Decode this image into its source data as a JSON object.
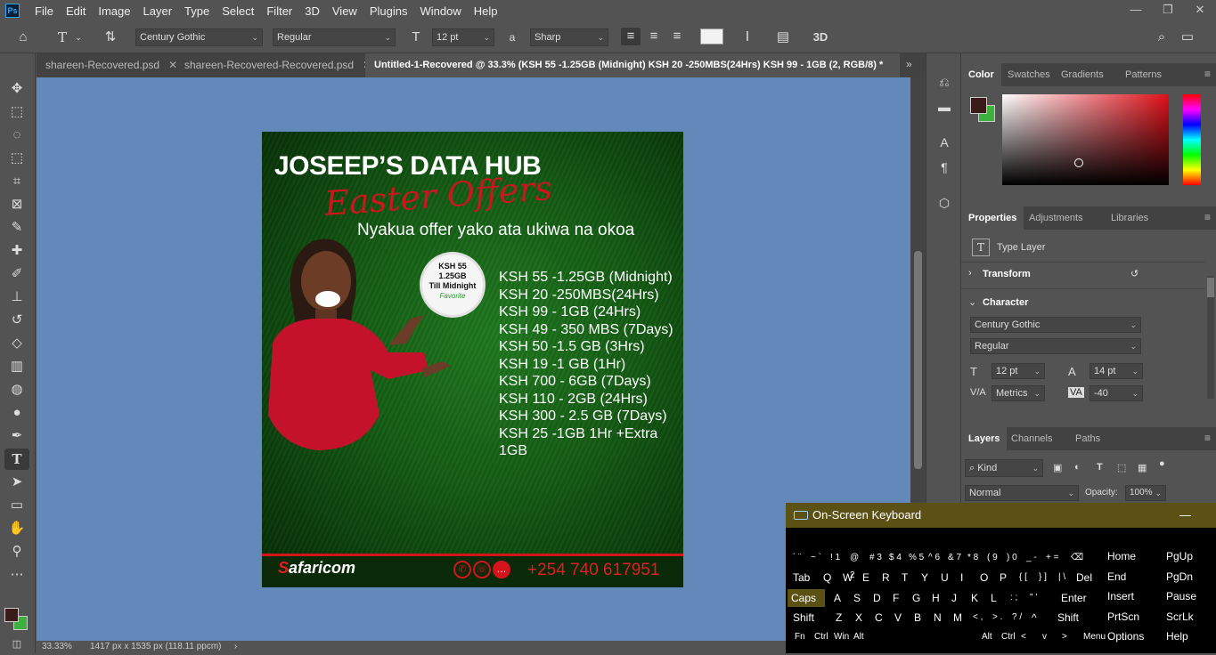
{
  "app": {
    "icon": "Ps"
  },
  "menu": [
    "File",
    "Edit",
    "Image",
    "Layer",
    "Type",
    "Select",
    "Filter",
    "3D",
    "View",
    "Plugins",
    "Window",
    "Help"
  ],
  "window_controls": {
    "minimize": "—",
    "restore": "❐",
    "close": "✕"
  },
  "options": {
    "font_family": "Century Gothic",
    "font_style": "Regular",
    "font_size": "12 pt",
    "antialias_icon_label": "a",
    "antialias": "Sharp",
    "threed_label": "3D"
  },
  "tabs": [
    {
      "label": "shareen-Recovered.psd",
      "close": "✕"
    },
    {
      "label": "shareen-Recovered-Recovered.psd",
      "close": "✕"
    },
    {
      "label": "Untitled-1-Recovered @ 33.3% (KSH 55 -1.25GB (Midnight) KSH 20 -250MBS(24Hrs) KSH 99 - 1GB (2, RGB/8) *",
      "close": "✕"
    }
  ],
  "status": {
    "zoom": "33.33%",
    "doc_info": "1417 px x 1535 px (118.11 ppcm)"
  },
  "artwork": {
    "title": "JOSEEP’S DATA HUB",
    "script": "Easter Offers",
    "subtitle": "Nyakua offer yako ata ukiwa na okoa",
    "badge": {
      "line1": "KSH 55",
      "line2": "1.25GB",
      "line3": "Till Midnight",
      "line4": "Favorite"
    },
    "offers": [
      "KSH 55 -1.25GB (Midnight)",
      "KSH 20 -250MBS(24Hrs)",
      "KSH 99 - 1GB (24Hrs)",
      "KSH 49 - 350 MBS (7Days)",
      "KSH 50 -1.5 GB (3Hrs)",
      "KSH 19 -1 GB (1Hr)",
      "KSH 700 - 6GB (7Days)",
      "KSH 110 - 2GB (24Hrs)",
      "KSH 300 - 2.5 GB (7Days)",
      "KSH 25 -1GB 1Hr +Extra 1GB"
    ],
    "brand_s": "S",
    "brand_rest": "afaricom",
    "phone": "+254 740 617951"
  },
  "color_panel": {
    "tabs": [
      "Color",
      "Swatches",
      "Gradients",
      "Patterns"
    ],
    "fg": "#3b1a1a",
    "bg": "#3cb13c"
  },
  "properties_panel": {
    "tabs": [
      "Properties",
      "Adjustments",
      "Libraries"
    ],
    "type_layer": "Type Layer",
    "transform": "Transform",
    "character": "Character",
    "font_family": "Century Gothic",
    "font_style": "Regular",
    "size": "12 pt",
    "leading": "14 pt",
    "kerning": "Metrics",
    "tracking": "-40"
  },
  "layers_panel": {
    "tabs": [
      "Layers",
      "Channels",
      "Paths"
    ],
    "kind": "Kind",
    "blend": "Normal",
    "opacity_label": "Opacity:",
    "opacity": "100%"
  },
  "osk": {
    "title": "On-Screen Keyboard",
    "minimize": "—",
    "row1": [
      {
        "k": "fn",
        "t": "´ ¨"
      },
      {
        "k": "tilde",
        "t": "~ `"
      },
      {
        "k": "1",
        "t": "! 1"
      },
      {
        "k": "2",
        "t": "@ 2"
      },
      {
        "k": "3",
        "t": "# 3"
      },
      {
        "k": "4",
        "t": "$ 4"
      },
      {
        "k": "5",
        "t": "% 5"
      },
      {
        "k": "6",
        "t": "^ 6"
      },
      {
        "k": "7",
        "t": "& 7"
      },
      {
        "k": "8",
        "t": "* 8"
      },
      {
        "k": "9",
        "t": "( 9"
      },
      {
        "k": "0",
        "t": ") 0"
      },
      {
        "k": "minus",
        "t": "_ -"
      },
      {
        "k": "plus",
        "t": "+ ="
      },
      {
        "k": "bksp",
        "t": "⌫"
      }
    ],
    "row2": [
      "Tab",
      "Q",
      "W",
      "E",
      "R",
      "T",
      "Y",
      "U",
      "I",
      "O",
      "P",
      "{ [",
      "} ]",
      "| \\",
      "Del"
    ],
    "row3": [
      "Caps",
      "A",
      "S",
      "D",
      "F",
      "G",
      "H",
      "J",
      "K",
      "L",
      ": ;",
      "\" '",
      "Enter"
    ],
    "row4": [
      "Shift",
      "Z",
      "X",
      "C",
      "V",
      "B",
      "N",
      "M",
      "< ,",
      "> .",
      "? /",
      "^",
      "Shift"
    ],
    "row5": [
      "Fn",
      "Ctrl",
      "Win",
      "Alt",
      "Alt",
      "Ctrl",
      "<",
      "v",
      ">",
      "Menu"
    ],
    "nav": [
      "Home",
      "PgUp",
      "End",
      "PgDn",
      "Insert",
      "Pause",
      "PrtScn",
      "ScrLk",
      "Options",
      "Help"
    ]
  }
}
